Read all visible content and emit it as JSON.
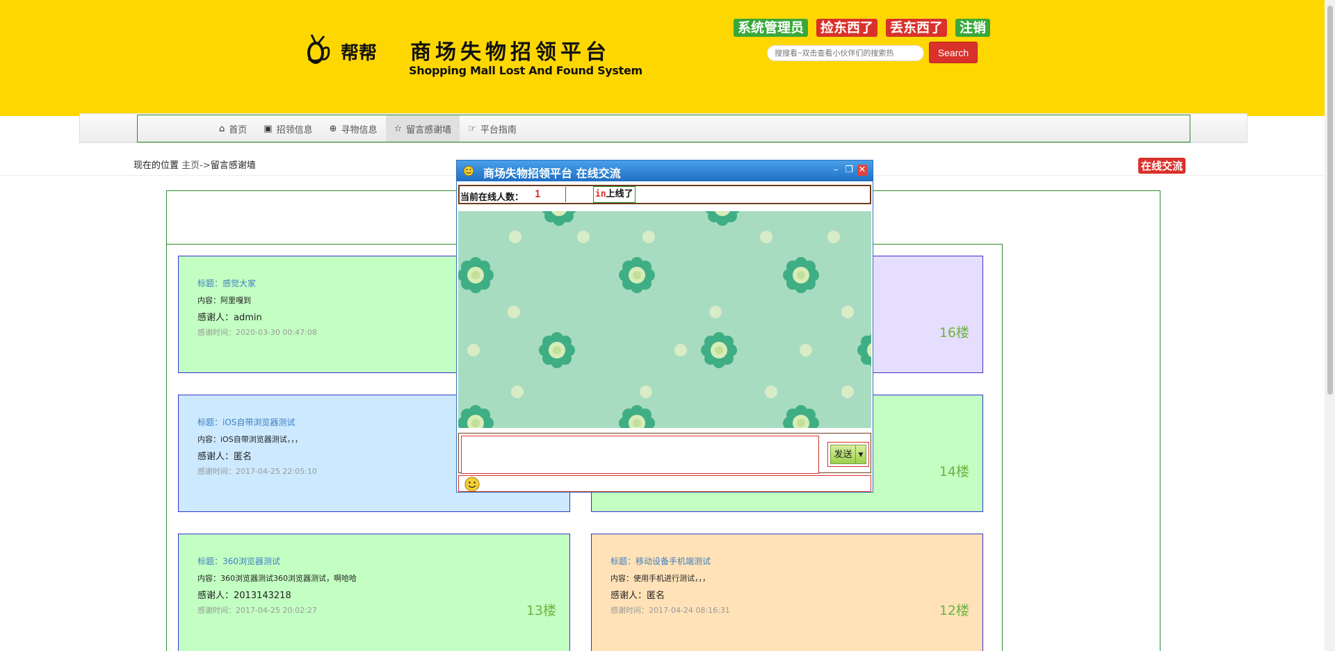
{
  "header": {
    "logo_text": "帮帮",
    "title": "商场失物招领平台",
    "subtitle": "Shopping Mall Lost And Found System",
    "links": [
      {
        "label": "系统管理员",
        "color": "#39a83a"
      },
      {
        "label": "捡东西了",
        "color": "#d9312b"
      },
      {
        "label": "丢东西了",
        "color": "#d9312b"
      },
      {
        "label": "注销",
        "color": "#39a83a"
      }
    ],
    "search_placeholder": "搜搜看~双击查看小伙伴们的搜索热",
    "search_button": "Search"
  },
  "nav": {
    "items": [
      {
        "label": "首页",
        "icon": "home-icon"
      },
      {
        "label": "招领信息",
        "icon": "picture-icon"
      },
      {
        "label": "寻物信息",
        "icon": "zoom-icon"
      },
      {
        "label": "留言感谢墙",
        "icon": "star-icon",
        "active": true
      },
      {
        "label": "平台指南",
        "icon": "hand-right-icon"
      }
    ]
  },
  "location": {
    "prefix": "现在的位置",
    "crumb": "主页->",
    "current": "留言感谢墙"
  },
  "chat_toggle": "在线交流",
  "cards": [
    {
      "title": "标题：感觉大家",
      "content": "内容：阿里嘎到",
      "person": "感谢人：admin",
      "time": "感谢时间：2020-03-30 00:47:08",
      "floor": "",
      "color": "#c3ffc3"
    },
    {
      "title": "",
      "content": "",
      "person": "",
      "time": "",
      "floor": "16楼",
      "color": "#e6deff"
    },
    {
      "title": "标题：iOS自带浏览器测试",
      "content": "内容：iOS自带浏览器测试，，，",
      "person": "感谢人：匿名",
      "time": "感谢时间：2017-04-25 22:05:10",
      "floor": "",
      "color": "#cce9ff"
    },
    {
      "title": "",
      "content": "",
      "person": "",
      "time": "",
      "floor": "14楼",
      "color": "#c3ffc3"
    },
    {
      "title": "标题：360浏览器测试",
      "content": "内容：360浏览器测试360浏览器测试，啊哈哈",
      "person": "感谢人：2013143218",
      "time": "感谢时间：2017-04-25 20:02:27",
      "floor": "13楼",
      "color": "#c3ffc3"
    },
    {
      "title": "标题：移动设备手机端测试",
      "content": "内容：使用手机进行测试，，，",
      "person": "感谢人：匿名",
      "time": "感谢时间：2017-04-24 08:16:31",
      "floor": "12楼",
      "color": "#ffe2b8"
    }
  ],
  "chat": {
    "title": "商场失物招领平台 在线交流",
    "online_label": "当前在线人数：",
    "online_count": "1",
    "notice_user": "in",
    "notice_text": "上线了",
    "send_label": "发送"
  },
  "colors": {
    "header_bg": "#ffd700",
    "accent_red": "#d9312b",
    "accent_green": "#39a83a",
    "chat_bg": "#a8dcc0"
  }
}
